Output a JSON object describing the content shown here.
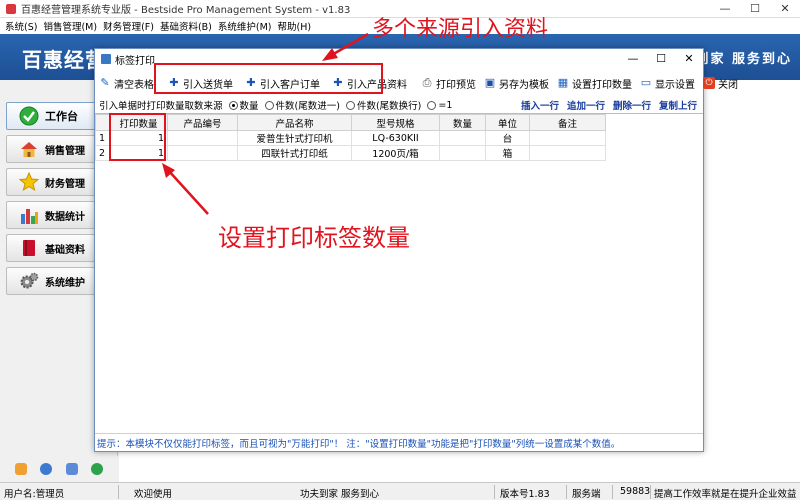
{
  "app": {
    "title": "百惠经营管理系统专业版 - Bestside Pro Management System - v1.83",
    "minimize": "—",
    "maximize": "☐",
    "close": "✕"
  },
  "menubar": [
    "系统(S)",
    "销售管理(M)",
    "财务管理(F)",
    "基础资料(B)",
    "系统维护(M)",
    "帮助(H)"
  ],
  "banner": {
    "title": "百惠经营",
    "slogan": "到家 服务到心"
  },
  "leftnav": [
    {
      "label": "工作台",
      "icon": "check-icon",
      "active": true
    },
    {
      "label": "销售管理",
      "icon": "house-icon",
      "active": false
    },
    {
      "label": "财务管理",
      "icon": "star-icon",
      "active": false
    },
    {
      "label": "数据统计",
      "icon": "bar-chart-icon",
      "active": false
    },
    {
      "label": "基础资料",
      "icon": "book-icon",
      "active": false
    },
    {
      "label": "系统维护",
      "icon": "gears-icon",
      "active": false
    }
  ],
  "dialog": {
    "title": "标签打印",
    "toolbar": {
      "clear": "清空表格",
      "import_delivery": "引入送货单",
      "import_order": "引入客户订单",
      "import_product": "引入产品资料",
      "print_preview": "打印预览",
      "save_template": "另存为模板",
      "set_count": "设置打印数量",
      "display": "显示设置",
      "close": "关闭"
    },
    "source_row": {
      "label": "引入单据时打印数量取数来源",
      "options": [
        "数量",
        "件数(尾数进一)",
        "件数(尾数换行)",
        "=1"
      ],
      "selected": 0,
      "actions": [
        "插入一行",
        "追加一行",
        "删除一行",
        "复制上行"
      ]
    },
    "columns": [
      "",
      "打印数量",
      "产品编号",
      "产品名称",
      "型号规格",
      "数量",
      "单位",
      "备注"
    ],
    "rows": [
      {
        "idx": "1",
        "print_qty": "1",
        "code": "",
        "name": "爱普生针式打印机",
        "spec": "LQ-630KII",
        "qty": "",
        "unit": "台",
        "remark": ""
      },
      {
        "idx": "2",
        "print_qty": "1",
        "code": "",
        "name": "四联针式打印纸",
        "spec": "1200页/箱",
        "qty": "",
        "unit": "箱",
        "remark": ""
      }
    ],
    "tip": "提示：本模块不仅仅能打印标签，而且可视为\"万能打印\"！ 注：\"设置打印数量\"功能是把\"打印数量\"列统一设置成某个数值。"
  },
  "annotations": {
    "top": "多个来源引入资料",
    "middle": "设置打印标签数量",
    "color": "#e0141e"
  },
  "statusbar": {
    "user": "用户名:管理员",
    "welcome": "欢迎使用",
    "motto": "功夫到家 服务到心",
    "version": "版本号1.83",
    "service_label": "服务端",
    "service_port": "59883",
    "slogan": "提高工作效率就是在提升企业效益"
  }
}
